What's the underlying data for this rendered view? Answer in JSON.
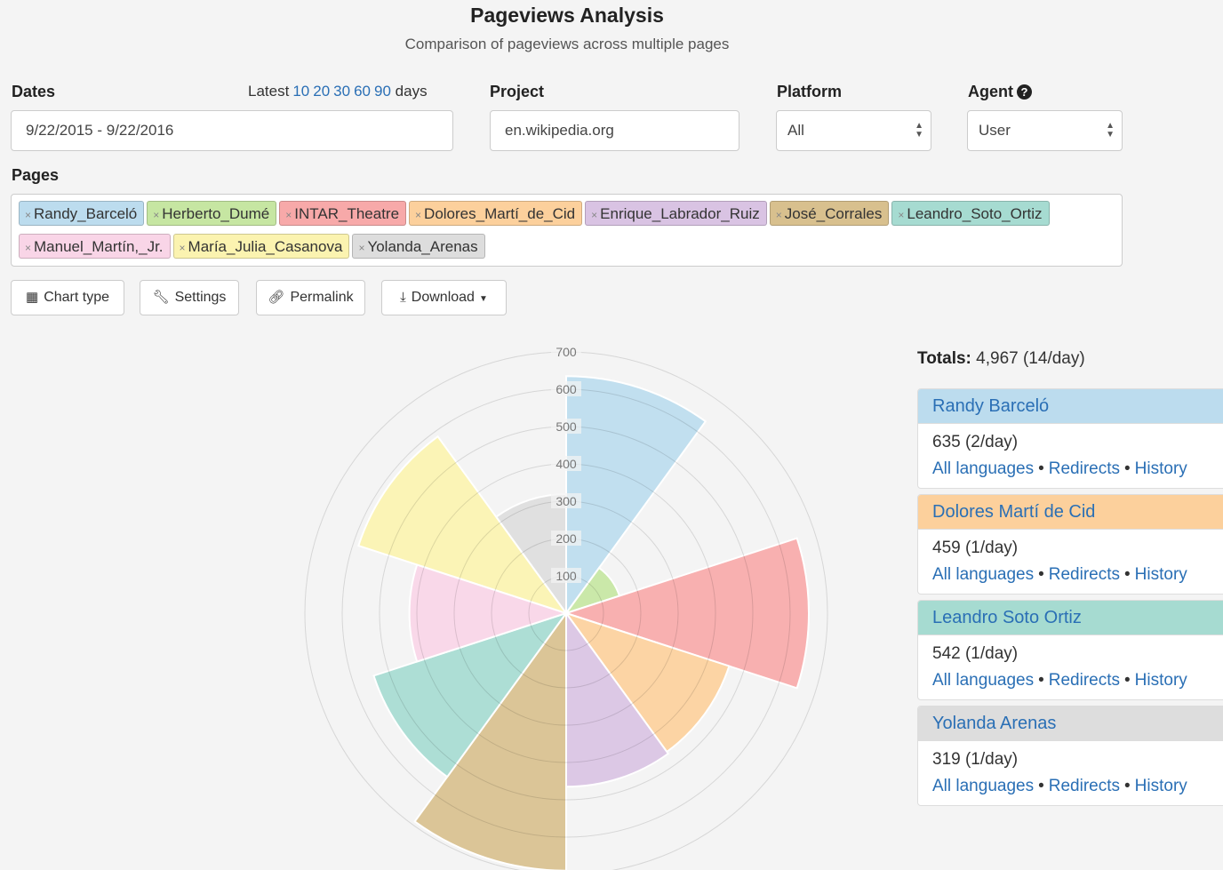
{
  "header": {
    "title": "Pageviews Analysis",
    "subtitle": "Comparison of pageviews across multiple pages"
  },
  "dates": {
    "label": "Dates",
    "value": "9/22/2015 - 9/22/2016",
    "latest_label": "Latest",
    "latest_options": [
      "10",
      "20",
      "30",
      "60",
      "90"
    ],
    "latest_suffix": "days"
  },
  "project": {
    "label": "Project",
    "value": "en.wikipedia.org"
  },
  "platform": {
    "label": "Platform",
    "value": "All"
  },
  "agent": {
    "label": "Agent",
    "value": "User",
    "help_icon": "question-circle-icon"
  },
  "pages": {
    "label": "Pages",
    "tags": [
      {
        "label": "Randy_Barceló",
        "color": "#bcdcee"
      },
      {
        "label": "Herberto_Dumé",
        "color": "#c6e6a2"
      },
      {
        "label": "INTAR_Theatre",
        "color": "#f7a9a9"
      },
      {
        "label": "Dolores_Martí_de_Cid",
        "color": "#fcd09c"
      },
      {
        "label": "Enrique_Labrador_Ruiz",
        "color": "#d9c3e3"
      },
      {
        "label": "José_Corrales",
        "color": "#d8c08e"
      },
      {
        "label": "Leandro_Soto_Ortiz",
        "color": "#a6dbd1"
      },
      {
        "label": "Manuel_Martín,_Jr.",
        "color": "#f9d5e7"
      },
      {
        "label": "María_Julia_Casanova",
        "color": "#fbf3b0"
      },
      {
        "label": "Yolanda_Arenas",
        "color": "#dddddd"
      }
    ]
  },
  "toolbar": {
    "chart_type": "Chart type",
    "settings": "Settings",
    "permalink": "Permalink",
    "download": "Download"
  },
  "totals": {
    "label": "Totals:",
    "value": "4,967 (14/day)"
  },
  "cards": [
    {
      "title": "Randy Barceló",
      "value": "635 (2/day)",
      "color": "#bcdcee"
    },
    {
      "title": "Dolores Martí de Cid",
      "value": "459 (1/day)",
      "color": "#fcd09c"
    },
    {
      "title": "Leandro Soto Ortiz",
      "value": "542 (1/day)",
      "color": "#a6dbd1"
    },
    {
      "title": "Yolanda Arenas",
      "value": "319 (1/day)",
      "color": "#dddddd"
    }
  ],
  "card_links": {
    "languages": "All languages",
    "redirects": "Redirects",
    "history": "History"
  },
  "chart_data": {
    "type": "polarArea",
    "categories": [
      "Randy_Barceló",
      "Herberto_Dumé",
      "INTAR_Theatre",
      "Dolores_Martí_de_Cid",
      "Enrique_Labrador_Ruiz",
      "José_Corrales",
      "Leandro_Soto_Ortiz",
      "Manuel_Martín,_Jr.",
      "María_Julia_Casanova",
      "Yolanda_Arenas"
    ],
    "values": [
      635,
      150,
      650,
      459,
      465,
      690,
      542,
      420,
      585,
      319
    ],
    "colors": [
      "#bcdcee",
      "#c6e6a2",
      "#f7a9a9",
      "#fcd09c",
      "#d9c3e3",
      "#d8c08e",
      "#a6dbd1",
      "#f9d5e7",
      "#fbf3b0",
      "#dddddd"
    ],
    "scale_max": 700,
    "ticks": [
      "100",
      "200",
      "300",
      "400",
      "500",
      "600",
      "700"
    ],
    "grid": true
  }
}
